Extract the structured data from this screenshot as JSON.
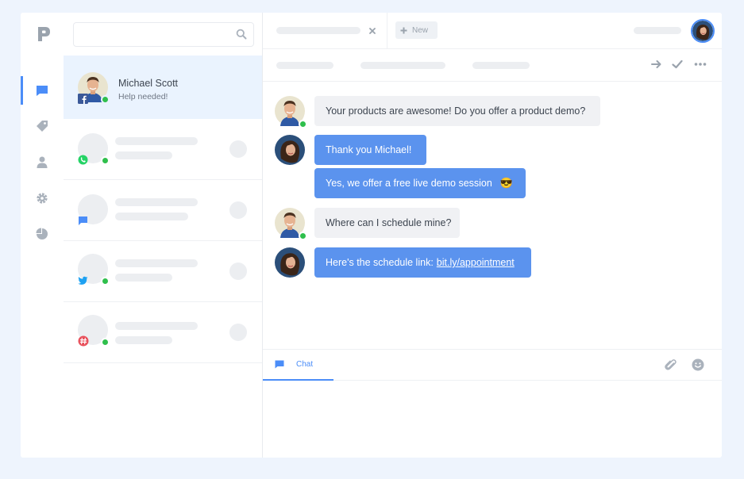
{
  "sidebar": {
    "items": [
      {
        "icon": "chat-bubble-icon",
        "active": true
      },
      {
        "icon": "tag-icon",
        "active": false
      },
      {
        "icon": "user-icon",
        "active": false
      },
      {
        "icon": "gear-icon",
        "active": false
      },
      {
        "icon": "pie-chart-icon",
        "active": false
      }
    ]
  },
  "search": {
    "placeholder": ""
  },
  "conversations": [
    {
      "name": "Michael Scott",
      "preview": "Help needed!",
      "channel": "facebook-icon",
      "active": true
    },
    {
      "channel": "whatsapp-icon"
    },
    {
      "channel": "chat-bubble-icon"
    },
    {
      "channel": "twitter-icon"
    },
    {
      "channel": "slack-icon"
    }
  ],
  "tabs": {
    "new_label": "New"
  },
  "messages": [
    {
      "from": "customer",
      "text": "Your products are awesome! Do you offer a product demo?"
    },
    {
      "from": "agent",
      "text": "Thank you Michael!"
    },
    {
      "from": "agent",
      "text": "Yes, we offer a free live demo session",
      "emoji": "😎"
    },
    {
      "from": "customer",
      "text": "Where can I schedule mine?"
    },
    {
      "from": "agent",
      "text": "Here's the schedule link:",
      "link": "bit.ly/appointment"
    }
  ],
  "composer": {
    "tab_label": "Chat"
  },
  "colors": {
    "accent": "#4b8df8",
    "agent_bubble": "#5b93ee",
    "customer_bubble": "#f0f1f4",
    "online": "#2fbf4c",
    "background": "#eef4fd"
  }
}
